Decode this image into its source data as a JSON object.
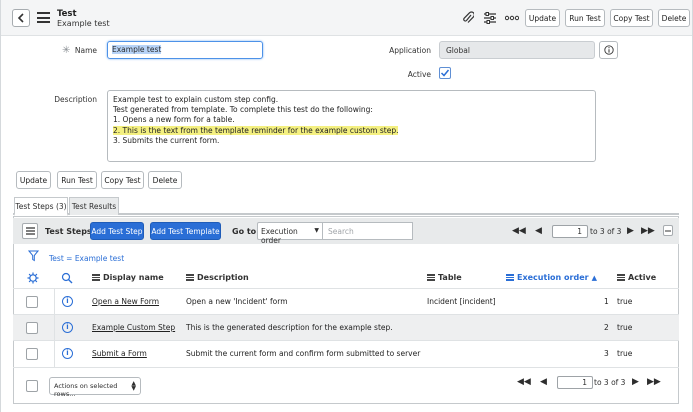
{
  "header": {
    "title": "Test",
    "subtitle": "Example test",
    "buttons": {
      "update": "Update",
      "run_test": "Run Test",
      "copy_test": "Copy Test",
      "delete": "Delete"
    },
    "icons": [
      "paperclip-icon",
      "settings-sliders-icon",
      "more-options-icon"
    ]
  },
  "form": {
    "name_label": "Name",
    "name_value": "Example test",
    "application_label": "Application",
    "application_value": "Global",
    "active_label": "Active",
    "active_checked": true,
    "description_label": "Description",
    "description_lines": [
      "Example test to explain custom step config.",
      "Test generated from template. To complete this test do the following:",
      "1. Opens a new form for a table.",
      "2. This is the text from the template reminder for the example custom step.",
      "3. Submits the current form."
    ]
  },
  "form_buttons": {
    "update": "Update",
    "run_test": "Run Test",
    "copy_test": "Copy Test",
    "delete": "Delete"
  },
  "tabs": [
    {
      "label": "Test Steps (3)",
      "active": true
    },
    {
      "label": "Test Results",
      "active": false
    }
  ],
  "list": {
    "title": "Test Steps",
    "add_step_label": "Add Test Step",
    "add_template_label": "Add Test Template",
    "goto_label": "Go to",
    "goto_field": "Execution order",
    "search_placeholder": "Search",
    "page_value": "1",
    "page_of": "to 3 of 3",
    "filter_breadcrumb": "Test = Example test",
    "columns": [
      "Display name",
      "Description",
      "Table",
      "Execution order",
      "Active"
    ],
    "sorted_column": "Execution order",
    "rows": [
      {
        "display_name": "Open a New Form",
        "description": "Open a new 'Incident' form",
        "table": "Incident [incident]",
        "execution_order": "1",
        "active": "true"
      },
      {
        "display_name": "Example Custom Step",
        "description": "This is the generated description for the example step.",
        "table": "",
        "execution_order": "2",
        "active": "true"
      },
      {
        "display_name": "Submit a Form",
        "description": "Submit the current form and confirm form submitted to server",
        "table": "",
        "execution_order": "3",
        "active": "true"
      }
    ],
    "actions_label": "Actions on selected rows...",
    "footer_page_value": "1",
    "footer_page_of": "to 3 of 3"
  },
  "colors": {
    "accent": "#2a6ed6",
    "highlight": "#f4f080",
    "header_bg": "#f4f5f6"
  }
}
